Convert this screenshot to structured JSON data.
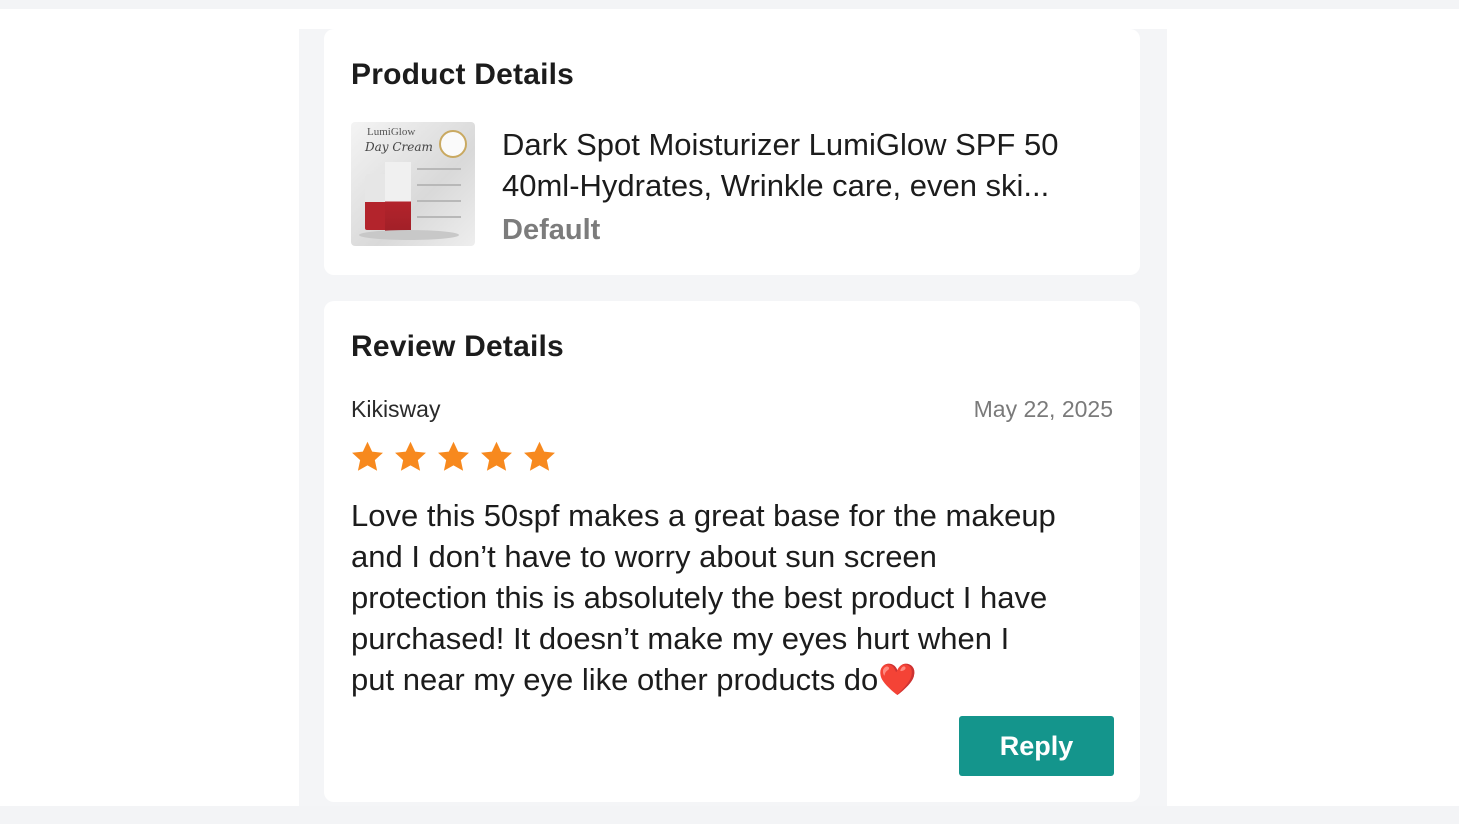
{
  "product_card": {
    "title": "Product Details",
    "product": {
      "name_line1": "Dark Spot Moisturizer LumiGlow SPF 50",
      "name_line2": "40ml-Hydrates,  Wrinkle care, even ski...",
      "variant": "Default",
      "thumbnail": {
        "brand": "LumiGlow",
        "script": "Day Cream"
      }
    }
  },
  "review_card": {
    "title": "Review Details",
    "reviewer": "Kikisway",
    "date": "May 22, 2025",
    "rating": 5,
    "rating_max": 5,
    "star_color": "#f7891e",
    "text_lines": [
      "Love this 50spf makes a great base for the makeup",
      "and I don’t have to worry about sun screen",
      "protection this is absolutely the best product I have",
      "purchased! It doesn’t make my eyes hurt when I",
      "put near my eye like other products do❤️"
    ],
    "reply_label": "Reply",
    "reply_color": "#14958c"
  }
}
